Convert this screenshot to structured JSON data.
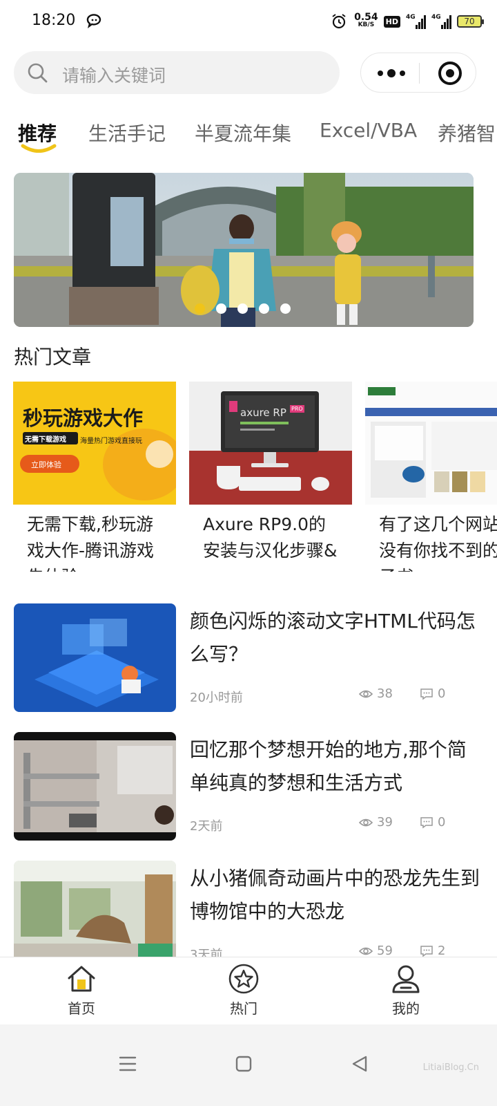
{
  "status_bar": {
    "time": "18:20",
    "net_speed": "0.54",
    "net_unit": "KB/S",
    "hd_label": "HD",
    "sig1_label": "4G",
    "sig2_label": "4G",
    "battery": "70"
  },
  "search": {
    "placeholder": "请输入关键词"
  },
  "tabs": [
    {
      "label": "推荐",
      "active": true
    },
    {
      "label": "生活手记"
    },
    {
      "label": "半夏流年集"
    },
    {
      "label": "Excel/VBA"
    },
    {
      "label": "养猪智"
    }
  ],
  "banner": {
    "slide_count": 5,
    "active_index": 0
  },
  "hot": {
    "title": "热门文章",
    "cards": [
      {
        "title": "无需下载,秒玩游戏大作-腾讯游戏先体验",
        "thumb_heading": "秒玩游戏大作",
        "thumb_tag": "无需下载游戏",
        "thumb_sub": "海量热门游戏直接玩",
        "thumb_button": "立即体验"
      },
      {
        "title": "Axure RP9.0的安装与汉化步骤&",
        "thumb_text": "axure RP",
        "thumb_badge": "PRO"
      },
      {
        "title": "有了这几个网站，没有你找不到的电子书"
      }
    ]
  },
  "articles": [
    {
      "title": "颜色闪烁的滚动文字HTML代码怎么写？",
      "time": "20小时前",
      "views": "38",
      "comments": "0"
    },
    {
      "title": "回忆那个梦想开始的地方,那个简单纯真的梦想和生活方式",
      "time": "2天前",
      "views": "39",
      "comments": "0"
    },
    {
      "title": "从小猪佩奇动画片中的恐龙先生到博物馆中的大恐龙",
      "time": "3天前",
      "views": "59",
      "comments": "2"
    }
  ],
  "tabbar": [
    {
      "label": "首页",
      "icon": "home-icon"
    },
    {
      "label": "热门",
      "icon": "star-icon"
    },
    {
      "label": "我的",
      "icon": "user-icon"
    }
  ],
  "watermark": "LitiaiBlog.Cn",
  "colors": {
    "accent": "#f0c419",
    "text": "#222222",
    "muted": "#999999"
  }
}
